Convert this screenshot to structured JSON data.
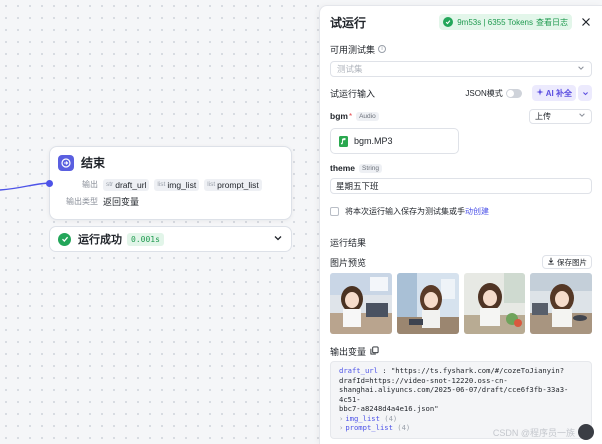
{
  "canvas": {
    "end_node": {
      "title": "结束",
      "output_label": "输出",
      "outputs": [
        {
          "type": "str",
          "name": "draft_url"
        },
        {
          "type": "list",
          "name": "img_list"
        },
        {
          "type": "list",
          "name": "prompt_list"
        }
      ],
      "output_type_label": "输出类型",
      "output_type_value": "返回变量"
    },
    "run_status": {
      "label": "运行成功",
      "time": "0.001s"
    }
  },
  "panel": {
    "title": "试运行",
    "status": "9m53s | 6355 Tokens",
    "view_log": "查看日志",
    "testset_label": "可用测试集",
    "testset_placeholder": "测试集",
    "input_label": "试运行输入",
    "json_mode": "JSON模式",
    "ai_fill": "AI 补全",
    "fields": {
      "bgm": {
        "name": "bgm",
        "required": "*",
        "type": "Audio",
        "upload": "上传",
        "file": "bgm.MP3"
      },
      "theme": {
        "name": "theme",
        "type": "String",
        "value": "星期五下班"
      }
    },
    "save_as_test": "将本次运行输入保存为测试集或手",
    "save_link": "动创建",
    "result_label": "运行结果",
    "image_preview": "图片预览",
    "save_images": "保存图片",
    "output_vars_label": "输出变量",
    "output": {
      "draft_key": "draft_url",
      "draft_lines": [
        "\"https://ts.fyshark.com/#/cozeToJianyin?",
        "drafId=https://video-snot-12220.oss-cn-",
        "shanghai.aliyuncs.com/2025-06-07/draft/cce6f3fb-33a3-4c51-",
        "bbc7-a8248d4a4e16.json\""
      ],
      "img_list_key": "img_list",
      "img_list_count": "(4)",
      "prompt_list_key": "prompt_list",
      "prompt_list_count": "(4)"
    }
  },
  "watermark": "CSDN @程序员一族",
  "icons": [
    "end-node-icon",
    "check-icon",
    "chevron-down-icon",
    "close-icon",
    "info-icon",
    "sparkle-icon",
    "audio-file-icon",
    "download-icon",
    "copy-icon",
    "checkbox-icon"
  ]
}
